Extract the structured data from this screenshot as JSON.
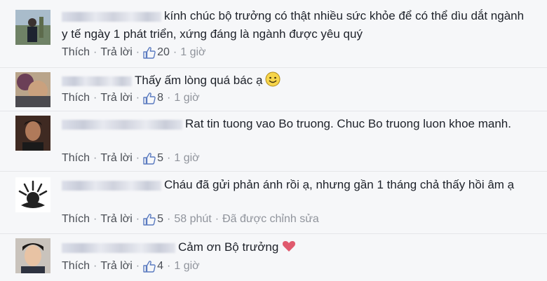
{
  "comments": [
    {
      "text": "kính chúc bộ trưởng có thật nhiều sức khỏe để có thể dìu dắt ngành y tế ngày 1 phát triển, xứng đáng là ngành được yêu quý",
      "like_label": "Thích",
      "reply_label": "Trả lời",
      "like_count": "20",
      "time": "1 giờ",
      "edited": ""
    },
    {
      "text": "Thấy ấm lòng quá bác ạ",
      "emoji": "smiley-emoji",
      "like_label": "Thích",
      "reply_label": "Trả lời",
      "like_count": "8",
      "time": "1 giờ",
      "edited": ""
    },
    {
      "text": "Rat tin tuong vao Bo truong. Chuc Bo truong luon khoe manh.",
      "like_label": "Thích",
      "reply_label": "Trả lời",
      "like_count": "5",
      "time": "1 giờ",
      "edited": ""
    },
    {
      "text": "Cháu đã gửi phản ánh rồi ạ, nhưng gần 1 tháng chả thấy hồi âm ạ",
      "like_label": "Thích",
      "reply_label": "Trả lời",
      "like_count": "5",
      "time": "58 phút",
      "edited": "Đã được chỉnh sửa"
    },
    {
      "text": "Cảm ơn Bộ trưởng",
      "emoji": "heart-emoji",
      "like_label": "Thích",
      "reply_label": "Trả lời",
      "like_count": "4",
      "time": "1 giờ",
      "edited": ""
    }
  ],
  "colors": {
    "background": "#f6f7f9",
    "text": "#1d2129",
    "action_text": "#4b4f56",
    "meta_text": "#90949c",
    "like_blue": "#5b7bc0",
    "heart": "#e05a6e"
  }
}
